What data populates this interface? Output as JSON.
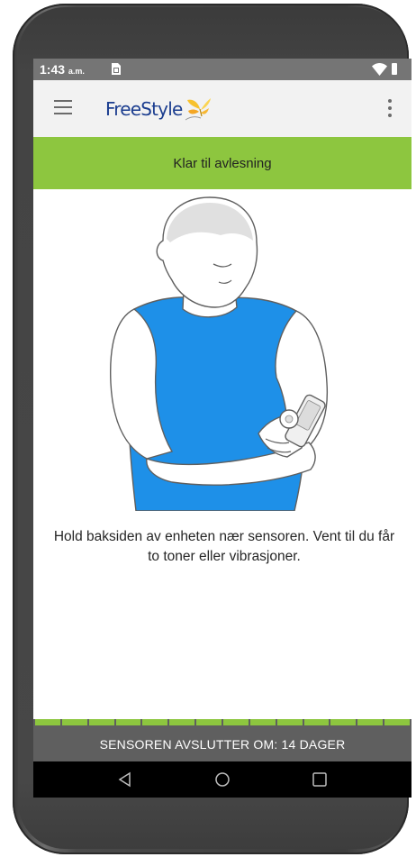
{
  "status_bar": {
    "time": "1:43",
    "ampm": "a.m."
  },
  "app_bar": {
    "logo_text": "FreeStyle",
    "menu_icon": "hamburger-menu-icon",
    "overflow_icon": "more-vert-icon"
  },
  "banner": {
    "text": "Klar til avlesning"
  },
  "instruction": {
    "text": "Hold baksiden av enheten nær sensoren. Vent til du får to toner eller vibrasjoner."
  },
  "footer": {
    "text": "SENSOREN AVSLUTTER OM: 14 DAGER"
  },
  "sensor_progress": {
    "segments_filled": 14,
    "segments_total": 14
  },
  "navigation": {
    "back_icon": "back-triangle-icon",
    "home_icon": "home-circle-icon",
    "recents_icon": "recents-square-icon"
  },
  "colors": {
    "accent_green": "#8dc63f",
    "status_bar": "#757575",
    "app_bar": "#f2f2f2",
    "footer": "#5f5f5f",
    "logo_blue": "#1b3d8f",
    "shirt_blue": "#1e90e8"
  }
}
